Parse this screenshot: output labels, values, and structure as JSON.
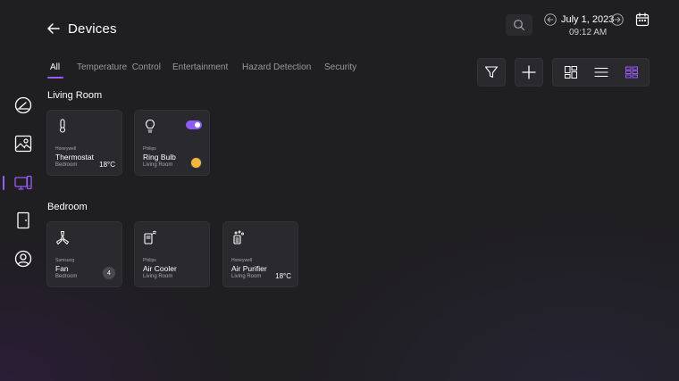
{
  "header": {
    "title": "Devices",
    "date": "July 1, 2023",
    "time": "09:12 AM"
  },
  "tabs": [
    {
      "label": "All",
      "active": true
    },
    {
      "label": "Temperature  Control",
      "active": false
    },
    {
      "label": "Entertainment",
      "active": false
    },
    {
      "label": "Hazard Detection",
      "active": false
    },
    {
      "label": "Security",
      "active": false
    }
  ],
  "sections": [
    {
      "title": "Living Room",
      "cards": [
        {
          "brand": "Honeywell",
          "name": "Thermostat",
          "room": "Bedroom",
          "value": "18°C",
          "icon": "thermometer-icon"
        },
        {
          "brand": "Philips",
          "name": "Ring Bulb",
          "room": "Living Room",
          "icon": "bulb-icon",
          "toggle_on": true,
          "status_color": "#f1b83b"
        }
      ]
    },
    {
      "title": "Bedroom",
      "cards": [
        {
          "brand": "Samsung",
          "name": "Fan",
          "room": "Bedroom",
          "badge": "4",
          "icon": "fan-icon"
        },
        {
          "brand": "Philips",
          "name": "Air Cooler",
          "room": "Living Room",
          "icon": "air-cooler-icon"
        },
        {
          "brand": "Honeywell",
          "name": "Air Purifier",
          "room": "Living Room",
          "value": "18°C",
          "icon": "air-purifier-icon"
        }
      ]
    }
  ],
  "sidebar": {
    "items": [
      {
        "icon": "gauge-icon",
        "active": false
      },
      {
        "icon": "picture-frame-icon",
        "active": false
      },
      {
        "icon": "devices-icon",
        "active": true
      },
      {
        "icon": "door-icon",
        "active": false
      },
      {
        "icon": "user-icon",
        "active": false
      }
    ]
  },
  "colors": {
    "accent": "#9b5cf6",
    "background": "#1f1e21",
    "card": "#2a2a2e",
    "bulb_status": "#f1b83b"
  }
}
